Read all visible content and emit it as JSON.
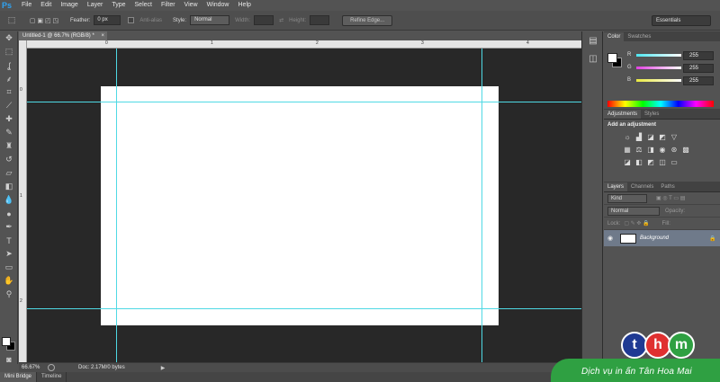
{
  "app": {
    "logo": "Ps"
  },
  "menu": [
    "File",
    "Edit",
    "Image",
    "Layer",
    "Type",
    "Select",
    "Filter",
    "View",
    "Window",
    "Help"
  ],
  "options": {
    "feather_label": "Feather:",
    "feather_value": "0 px",
    "antialias_label": "Anti-alias",
    "style_label": "Style:",
    "style_value": "Normal",
    "width_label": "Width:",
    "height_label": "Height:",
    "refine_label": "Refine Edge...",
    "workspace": "Essentials"
  },
  "document": {
    "tab_title": "Untitled-1 @ 66.7% (RGB/8) *",
    "close": "×",
    "ruler_h": [
      "0",
      "1",
      "2",
      "3",
      "4"
    ],
    "ruler_v": [
      "0",
      "1",
      "2"
    ]
  },
  "status": {
    "zoom": "66.67%",
    "doc": "Doc: 2.17M/0 bytes",
    "arrow": "▶"
  },
  "bottom_tabs": [
    "Mini Bridge",
    "Timeline"
  ],
  "color_panel": {
    "tabs": [
      "Color",
      "Swatches"
    ],
    "channels": [
      {
        "label": "R",
        "value": "255",
        "color": "#e02020"
      },
      {
        "label": "G",
        "value": "255",
        "color": "#d020d0"
      },
      {
        "label": "B",
        "value": "255",
        "color": "#e0e020"
      }
    ]
  },
  "adjustments_panel": {
    "tabs": [
      "Adjustments",
      "Styles"
    ],
    "title": "Add an adjustment"
  },
  "layers_panel": {
    "tabs": [
      "Layers",
      "Channels",
      "Paths"
    ],
    "kind": "Kind",
    "blend_mode": "Normal",
    "opacity_label": "Opacity:",
    "fill_label": "Fill:",
    "lock_label": "Lock:",
    "layer_name": "Background"
  },
  "watermark": {
    "letters": [
      "t",
      "h",
      "m"
    ],
    "text": "Dịch vụ in ấn Tân Hoa Mai"
  }
}
